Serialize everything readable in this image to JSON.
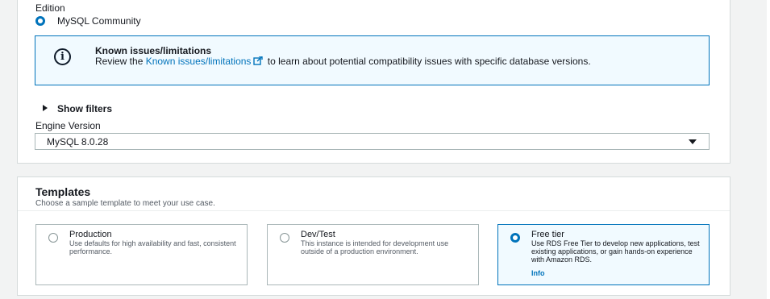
{
  "engine": {
    "edition_label": "Edition",
    "edition_value": "MySQL Community",
    "info": {
      "title": "Known issues/limitations",
      "body_prefix": "Review the ",
      "link_text": "Known issues/limitations",
      "body_suffix": " to learn about potential compatibility issues with specific database versions."
    },
    "show_filters": "Show filters",
    "version_label": "Engine Version",
    "version_value": "MySQL 8.0.28"
  },
  "templates": {
    "title": "Templates",
    "description": "Choose a sample template to meet your use case.",
    "options": [
      {
        "title": "Production",
        "description": "Use defaults for high availability and fast, consistent performance.",
        "selected": false
      },
      {
        "title": "Dev/Test",
        "description": "This instance is intended for development use outside of a production environment.",
        "selected": false
      },
      {
        "title": "Free tier",
        "description": "Use RDS Free Tier to develop new applications, test existing applications, or gain hands-on experience with Amazon RDS.",
        "selected": true,
        "info_link": "Info"
      }
    ]
  },
  "colors": {
    "accent": "#0073bb",
    "info_bg": "#f1faff",
    "border": "#aab7b8",
    "page_bg": "#f2f3f3"
  },
  "icons": [
    "info-icon",
    "external-link-icon",
    "caret-right-icon",
    "caret-down-icon"
  ]
}
